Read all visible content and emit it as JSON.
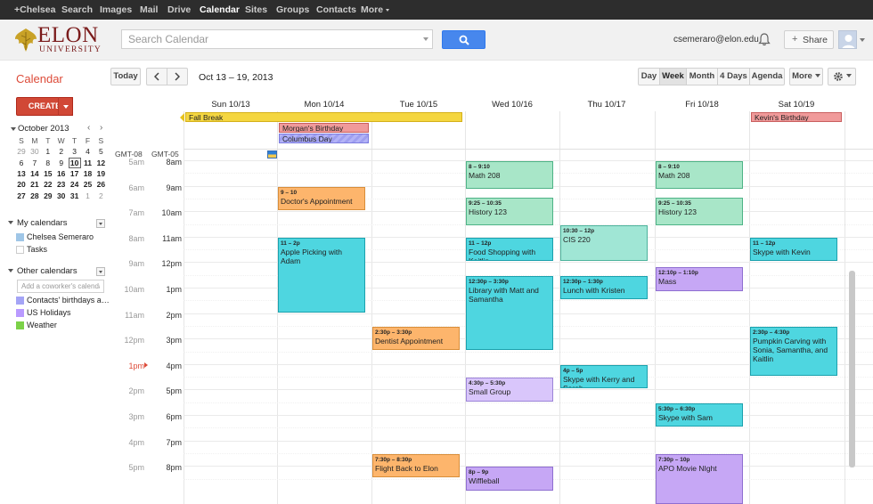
{
  "topbar": {
    "items": [
      "+Chelsea",
      "Search",
      "Images",
      "Mail",
      "Drive",
      "Calendar",
      "Sites",
      "Groups",
      "Contacts",
      "More"
    ],
    "active": "Calendar"
  },
  "header": {
    "logo_word": "ELON",
    "logo_sub": "UNIVERSITY",
    "search_placeholder": "Search Calendar",
    "user_email": "csemeraro@elon.edu",
    "share_label": "Share"
  },
  "toolbar": {
    "app_title": "Calendar",
    "today_label": "Today",
    "date_range": "Oct 13 – 19, 2013",
    "views": [
      "Day",
      "Week",
      "Month",
      "4 Days",
      "Agenda"
    ],
    "selected_view": "Week",
    "more_label": "More"
  },
  "sidebar": {
    "create_label": "CREATE",
    "mini_cal": {
      "month": "October 2013",
      "dow": [
        "S",
        "M",
        "T",
        "W",
        "T",
        "F",
        "S"
      ],
      "weeks": [
        [
          "29",
          "30",
          "1",
          "2",
          "3",
          "4",
          "5"
        ],
        [
          "6",
          "7",
          "8",
          "9",
          "10",
          "11",
          "12"
        ],
        [
          "13",
          "14",
          "15",
          "16",
          "17",
          "18",
          "19"
        ],
        [
          "20",
          "21",
          "22",
          "23",
          "24",
          "25",
          "26"
        ],
        [
          "27",
          "28",
          "29",
          "30",
          "31",
          "1",
          "2"
        ]
      ],
      "today": "10"
    },
    "my_calendars_label": "My calendars",
    "my_calendars": [
      {
        "name": "Chelsea Semeraro",
        "color": "#9fc6e7"
      },
      {
        "name": "Tasks",
        "color": "#ffffff"
      }
    ],
    "other_calendars_label": "Other calendars",
    "coworker_placeholder": "Add a coworker's calendar",
    "other_calendars": [
      {
        "name": "Contacts' birthdays a…",
        "color": "#a4a4f6"
      },
      {
        "name": "US Holidays",
        "color": "#b99aff"
      },
      {
        "name": "Weather",
        "color": "#7bd148"
      }
    ]
  },
  "calendar": {
    "days": [
      "Sun 10/13",
      "Mon 10/14",
      "Tue 10/15",
      "Wed 10/16",
      "Thu 10/17",
      "Fri 10/18",
      "Sat 10/19"
    ],
    "tz_labels": [
      "GMT-08",
      "GMT-05"
    ],
    "secondary_times": [
      "5am",
      "6am",
      "7am",
      "8am",
      "9am",
      "10am",
      "11am",
      "12pm",
      "1pm",
      "2pm",
      "3pm",
      "4pm",
      "5pm"
    ],
    "primary_times": [
      "8am",
      "9am",
      "10am",
      "11am",
      "12pm",
      "1pm",
      "2pm",
      "3pm",
      "4pm",
      "5pm",
      "6pm",
      "7pm",
      "8pm"
    ],
    "allday_events": [
      {
        "title": "Fall Break",
        "color": "#f4d640"
      },
      {
        "title": "Morgan's Birthday",
        "color": "#f09a9a"
      },
      {
        "title": "Columbus Day",
        "color": "#b3b3f7"
      },
      {
        "title": "Kevin's Birthday",
        "color": "#f09a9a"
      }
    ],
    "events": [
      {
        "time": "9 – 10",
        "title": "Doctor's Appointment"
      },
      {
        "time": "11 – 2p",
        "title": "Apple Picking with Adam"
      },
      {
        "time": "2:30p – 3:30p",
        "title": "Dentist Appointment"
      },
      {
        "time": "7:30p – 8:30p",
        "title": "Flight Back to Elon"
      },
      {
        "time": "8 – 9:10",
        "title": "Math 208"
      },
      {
        "time": "9:25 – 10:35",
        "title": "History 123"
      },
      {
        "time": "11 – 12p",
        "title": "Food Shopping with Kaitlin"
      },
      {
        "time": "12:30p – 3:30p",
        "title": "Library with Matt and Samantha"
      },
      {
        "time": "4:30p – 5:30p",
        "title": "Small Group"
      },
      {
        "time": "8p – 9p",
        "title": "Wiffleball"
      },
      {
        "time": "10:30 – 12p",
        "title": "CIS 220"
      },
      {
        "time": "12:30p – 1:30p",
        "title": "Lunch with Kristen"
      },
      {
        "time": "4p – 5p",
        "title": "Skype with Kerry and Sarah"
      },
      {
        "time": "8 – 9:10",
        "title": "Math 208"
      },
      {
        "time": "9:25 – 10:35",
        "title": "History 123"
      },
      {
        "time": "12:10p – 1:10p",
        "title": "Mass"
      },
      {
        "time": "5:30p – 6:30p",
        "title": "Skype with Sam"
      },
      {
        "time": "7:30p – 10p",
        "title": "APO Movie NIght"
      },
      {
        "time": "11 – 12p",
        "title": "Skype with Kevin"
      },
      {
        "time": "2:30p – 4:30p",
        "title": "Pumpkin Carving with Sonia, Samantha, and Kaitlin"
      }
    ]
  }
}
